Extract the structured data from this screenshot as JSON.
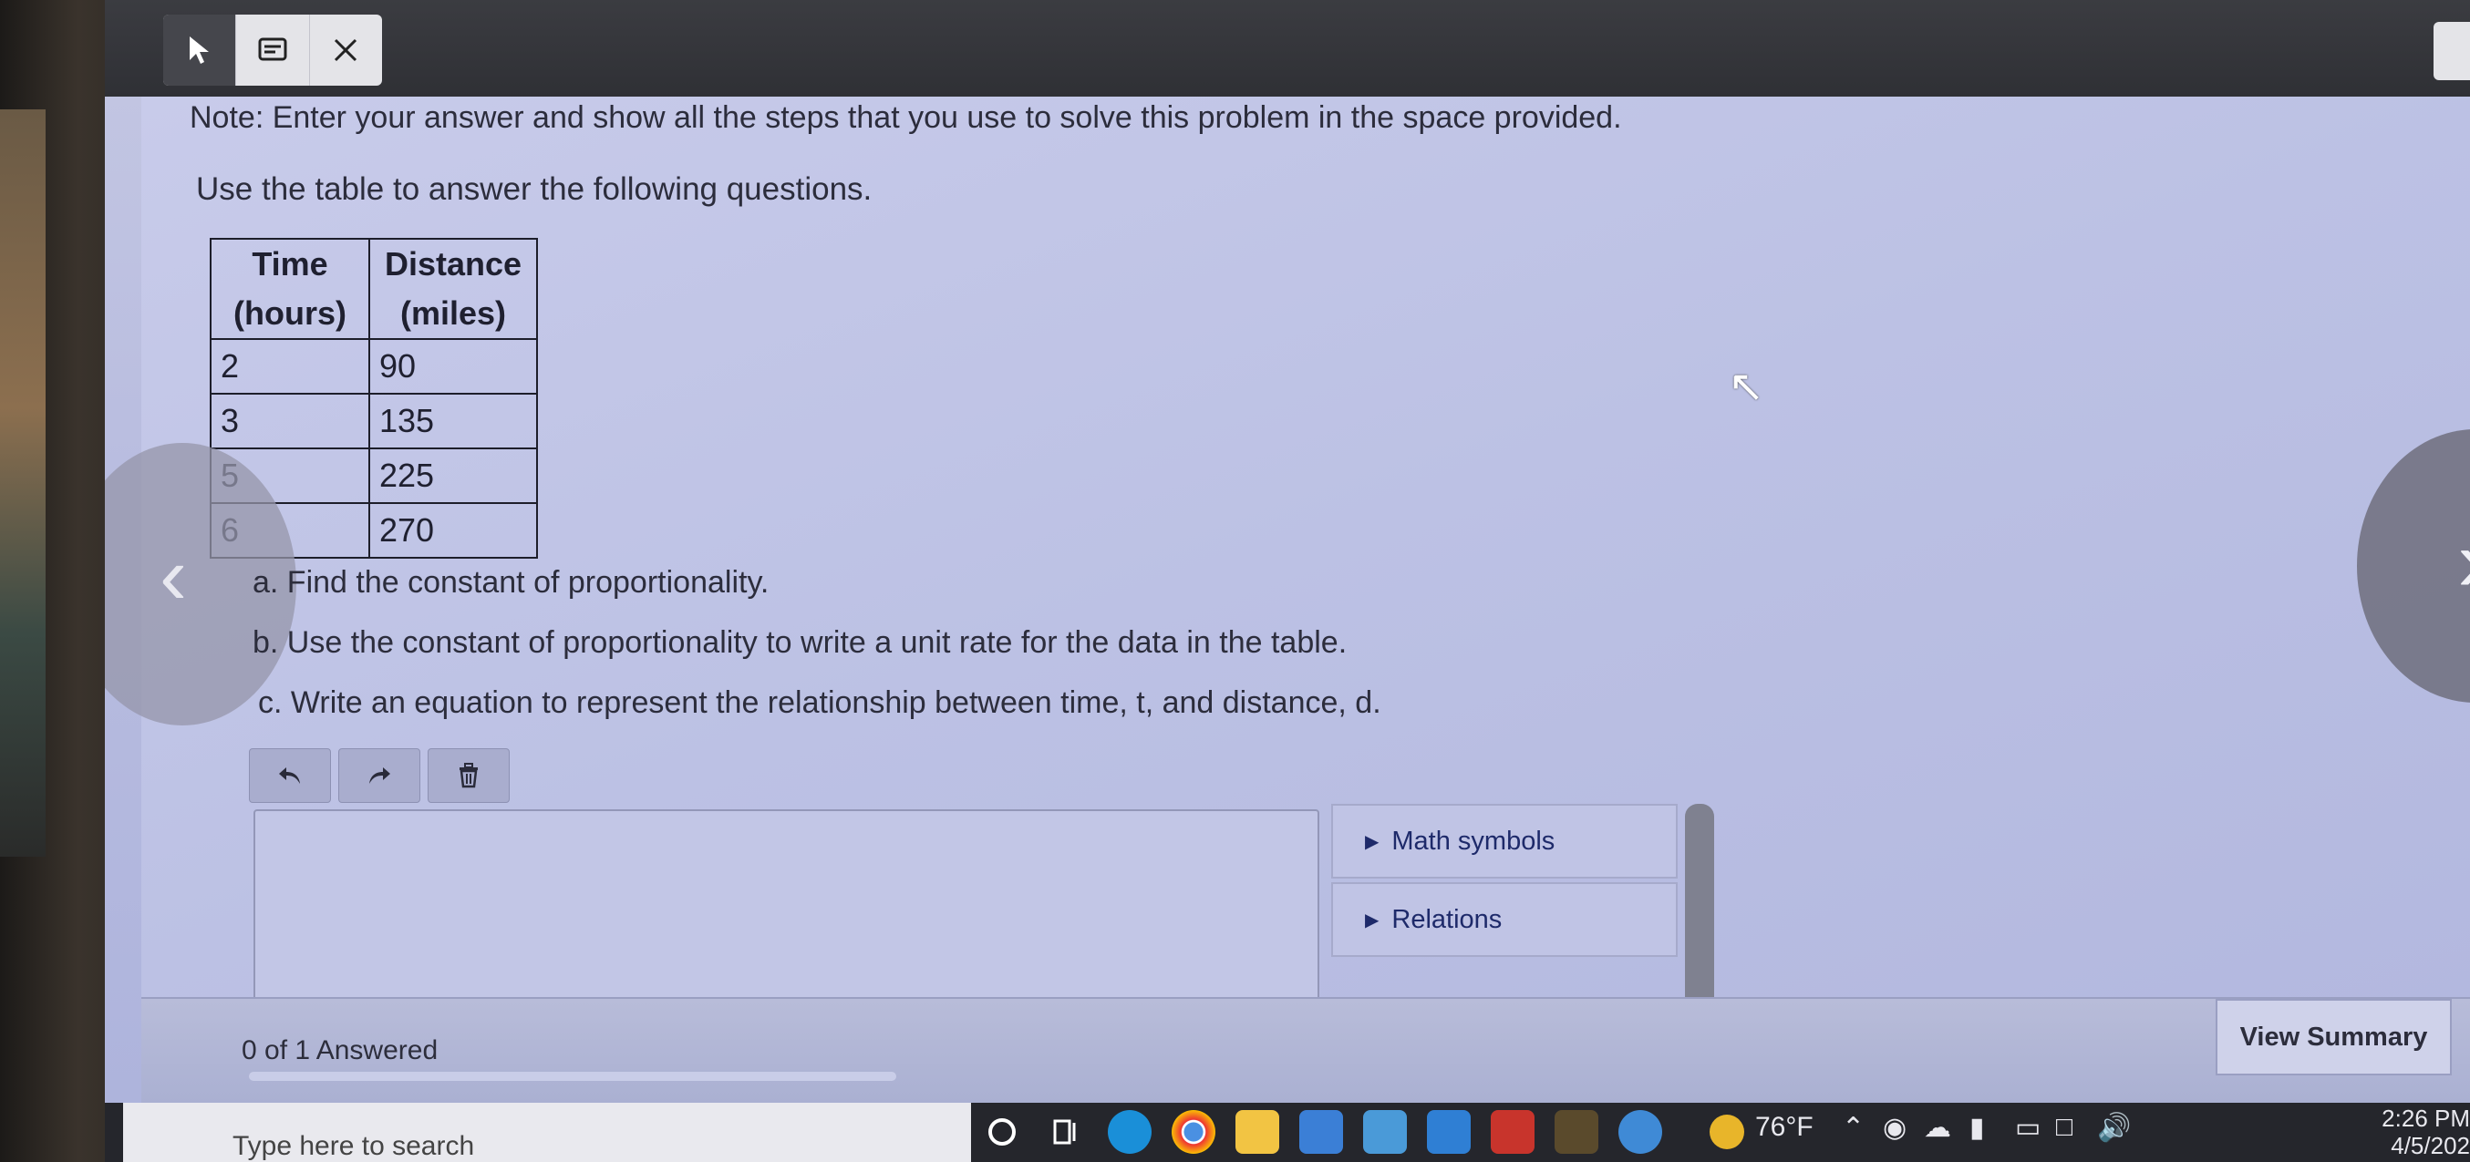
{
  "toolbar": {
    "pointer_icon": "pointer-icon",
    "notes_icon": "notes-icon",
    "close_icon": "close-icon"
  },
  "question": {
    "note": "Note: Enter your answer and show all the steps that you use to solve this problem in the space provided.",
    "intro": "Use the table to answer the following questions.",
    "table": {
      "headers": [
        {
          "line1": "Time",
          "line2": "(hours)"
        },
        {
          "line1": "Distance",
          "line2": "(miles)"
        }
      ],
      "rows": [
        [
          "2",
          "90"
        ],
        [
          "3",
          "135"
        ],
        [
          "5",
          "225"
        ],
        [
          "6",
          "270"
        ]
      ]
    },
    "part_a": "a. Find the constant of proportionality.",
    "part_b": "b. Use the constant of proportionality to write a unit rate for the data in the table.",
    "part_c": "c. Write an equation to represent the relationship between time, t, and distance, d."
  },
  "editor": {
    "undo_icon": "undo-icon",
    "redo_icon": "redo-icon",
    "delete_icon": "trash-icon",
    "answer_value": "",
    "panels": [
      "Math symbols",
      "Relations"
    ]
  },
  "footer": {
    "answered": "0 of 1 Answered",
    "progress": 0,
    "summary_button": "View Summary"
  },
  "taskbar": {
    "search_placeholder": "Type here to search",
    "weather": "76°F",
    "time": "2:26 PM",
    "date": "4/5/202"
  },
  "colors": {
    "screen_bg": "#bcc1e4",
    "topbar": "#2f3035",
    "link_blue": "#1e2a6a"
  }
}
